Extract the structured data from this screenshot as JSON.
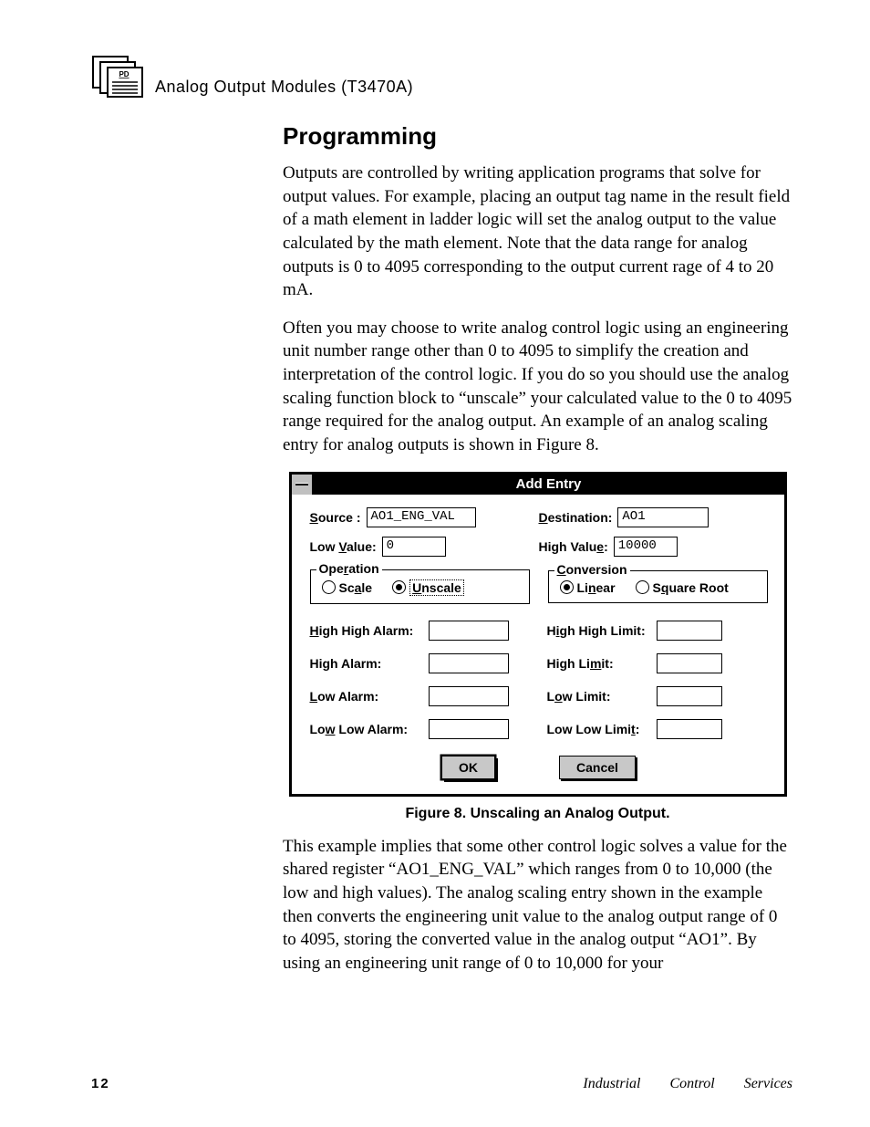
{
  "header": {
    "title": "Analog  Output  Modules (T3470A)"
  },
  "section": {
    "heading": "Programming",
    "para1": "Outputs are controlled by writing application programs that solve for output values.  For example, placing an output tag name in the result field of a math element in ladder logic will set the analog output to the value calculated by the math element.  Note that the data range for analog outputs is 0 to 4095 corresponding to the output current rage of 4 to 20 mA.",
    "para2": "Often you may choose to write analog control logic using an engineering unit number range other than 0 to 4095 to simplify the creation and interpretation of the control logic.  If you do so you should use the analog scaling function block to “unscale” your calculated value to the 0 to 4095 range required for the analog output.  An example of an analog scaling entry for analog outputs is shown in Figure 8.",
    "caption": "Figure 8.  Unscaling an Analog Output.",
    "para3": "This example implies that some other control logic solves a value for the shared register “AO1_ENG_VAL” which ranges from 0 to 10,000 (the low and high values).  The analog scaling entry shown in the example then converts the engineering unit value to the analog output range of 0 to 4095, storing the converted value in the analog output “AO1”.  By using an engineering unit range of 0 to 10,000 for your"
  },
  "dialog": {
    "title": "Add Entry",
    "labels": {
      "source_pre": "S",
      "source_post": "ource :",
      "dest_pre": "D",
      "dest_post": "estination:",
      "lowval_pre": "Low ",
      "lowval_u": "V",
      "lowval_post": "alue:",
      "highval_pre": "High Valu",
      "highval_u": "e",
      "highval_post": ":",
      "op_pre": "Ope",
      "op_u": "r",
      "op_post": "ation",
      "scale_pre": "Sc",
      "scale_u": "a",
      "scale_post": "le",
      "unscale_pre": "",
      "unscale_u": "U",
      "unscale_post": "nscale",
      "conv_pre": "",
      "conv_u": "C",
      "conv_post": "onversion",
      "linear_pre": "Li",
      "linear_u": "n",
      "linear_post": "ear",
      "sqrt_pre": "S",
      "sqrt_u": "q",
      "sqrt_post": "uare Root",
      "hh_alarm_pre": "",
      "hh_alarm_u": "H",
      "hh_alarm_post": "igh High Alarm:",
      "h_alarm": "High Alarm:",
      "l_alarm_pre": "",
      "l_alarm_u": "L",
      "l_alarm_post": "ow Alarm:",
      "ll_alarm_pre": "Lo",
      "ll_alarm_u": "w",
      "ll_alarm_post": " Low Alarm:",
      "hh_limit_pre": "H",
      "hh_limit_u": "i",
      "hh_limit_post": "gh High Limit:",
      "h_limit_pre": "High Li",
      "h_limit_u": "m",
      "h_limit_post": "it:",
      "l_limit_pre": "L",
      "l_limit_u": "o",
      "l_limit_post": "w Limit:",
      "ll_limit_pre": "Low Low Limi",
      "ll_limit_u": "t",
      "ll_limit_post": ":",
      "ok": "OK",
      "cancel": "Cancel"
    },
    "values": {
      "source": "AO1_ENG_VAL",
      "destination": "AO1",
      "low_value": "0",
      "high_value": "10000",
      "operation_selected": "unscale",
      "conversion_selected": "linear",
      "high_high_alarm": "",
      "high_alarm": "",
      "low_alarm": "",
      "low_low_alarm": "",
      "high_high_limit": "",
      "high_limit": "",
      "low_limit": "",
      "low_low_limit": ""
    }
  },
  "footer": {
    "page": "12",
    "right": "Industrial Control Services"
  }
}
